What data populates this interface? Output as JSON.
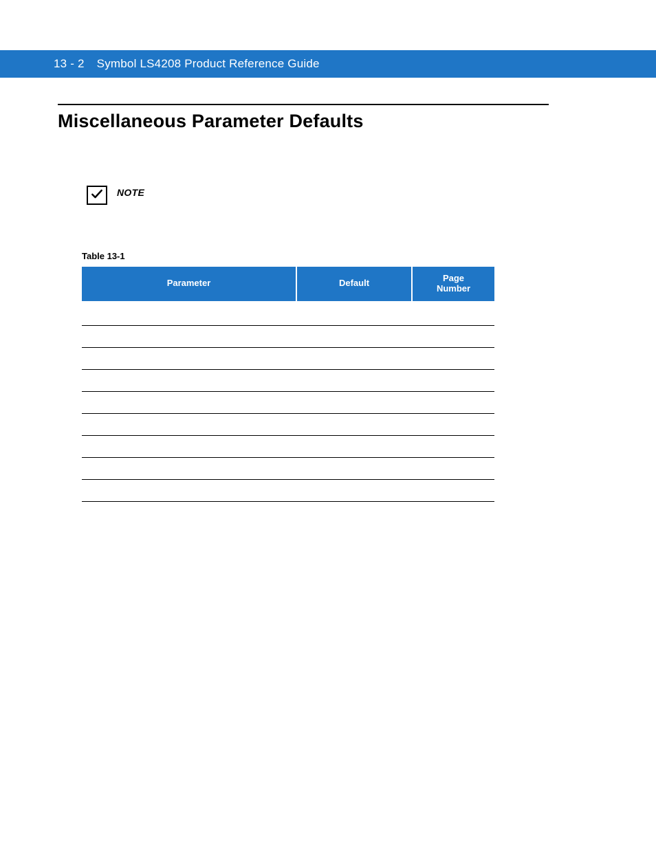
{
  "header": {
    "page_ref": "13 - 2",
    "doc_title": "Symbol LS4208 Product Reference Guide"
  },
  "section": {
    "title": "Miscellaneous Parameter Defaults"
  },
  "note": {
    "label": "NOTE",
    "icon": "checkmark-icon"
  },
  "table": {
    "caption": "Table 13-1",
    "columns": [
      {
        "label": "Parameter"
      },
      {
        "label": "Default"
      },
      {
        "label_line1": "Page",
        "label_line2": "Number"
      }
    ],
    "rows": [
      {
        "parameter": "",
        "default": "",
        "page": ""
      },
      {
        "parameter": "",
        "default": "",
        "page": ""
      },
      {
        "parameter": "",
        "default": "",
        "page": ""
      },
      {
        "parameter": "",
        "default": "",
        "page": ""
      },
      {
        "parameter": "",
        "default": "",
        "page": ""
      },
      {
        "parameter": "",
        "default": "",
        "page": ""
      },
      {
        "parameter": "",
        "default": "",
        "page": ""
      },
      {
        "parameter": "",
        "default": "",
        "page": ""
      },
      {
        "parameter": "",
        "default": "",
        "page": ""
      }
    ]
  }
}
